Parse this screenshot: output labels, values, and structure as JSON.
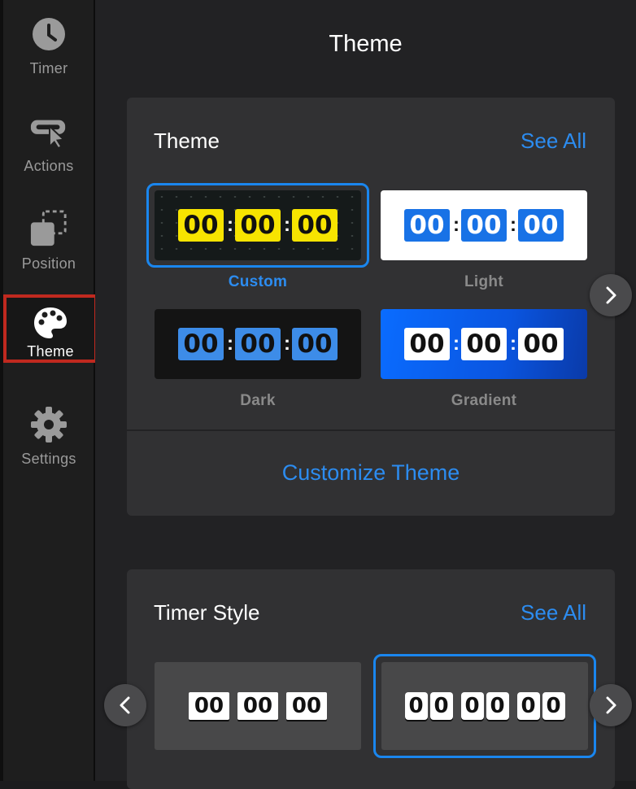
{
  "sidebar": {
    "items": [
      {
        "label": "Timer",
        "icon": "clock-icon"
      },
      {
        "label": "Actions",
        "icon": "pointer-icon"
      },
      {
        "label": "Position",
        "icon": "position-icon"
      },
      {
        "label": "Theme",
        "icon": "palette-icon",
        "active": true
      },
      {
        "label": "Settings",
        "icon": "gear-icon"
      }
    ]
  },
  "header": {
    "title": "Theme"
  },
  "theme_card": {
    "title": "Theme",
    "see_all": "See All",
    "themes": [
      {
        "label": "Custom",
        "digits": [
          "00",
          "00",
          "00"
        ],
        "selected": true,
        "digit_bg": "#f7e400",
        "digit_color": "#111111",
        "bg": "#151a1a"
      },
      {
        "label": "Light",
        "digits": [
          "00",
          "00",
          "00"
        ],
        "digit_bg": "#1872e6",
        "digit_color": "#ffffff",
        "bg": "#ffffff"
      },
      {
        "label": "Dark",
        "digits": [
          "00",
          "00",
          "00"
        ],
        "digit_bg": "#3d8ce8",
        "digit_color": "#111111",
        "bg": "#141414"
      },
      {
        "label": "Gradient",
        "digits": [
          "00",
          "00",
          "00"
        ],
        "digit_bg": "#ffffff",
        "digit_color": "#111111",
        "bg": "#0a5ff0"
      }
    ],
    "customize_label": "Customize Theme",
    "next_icon": "chevron-right-icon"
  },
  "timer_style_card": {
    "title": "Timer Style",
    "see_all": "See All",
    "styles": [
      {
        "name": "single-flip",
        "digits": [
          "00",
          "00",
          "00"
        ]
      },
      {
        "name": "split-flip",
        "digits": [
          "0",
          "0",
          "0",
          "0",
          "0",
          "0"
        ],
        "selected": true
      }
    ],
    "prev_icon": "chevron-left-icon",
    "next_icon": "chevron-right-icon"
  },
  "colors": {
    "accent": "#2c8cf0",
    "active_outline": "#c0291f"
  }
}
